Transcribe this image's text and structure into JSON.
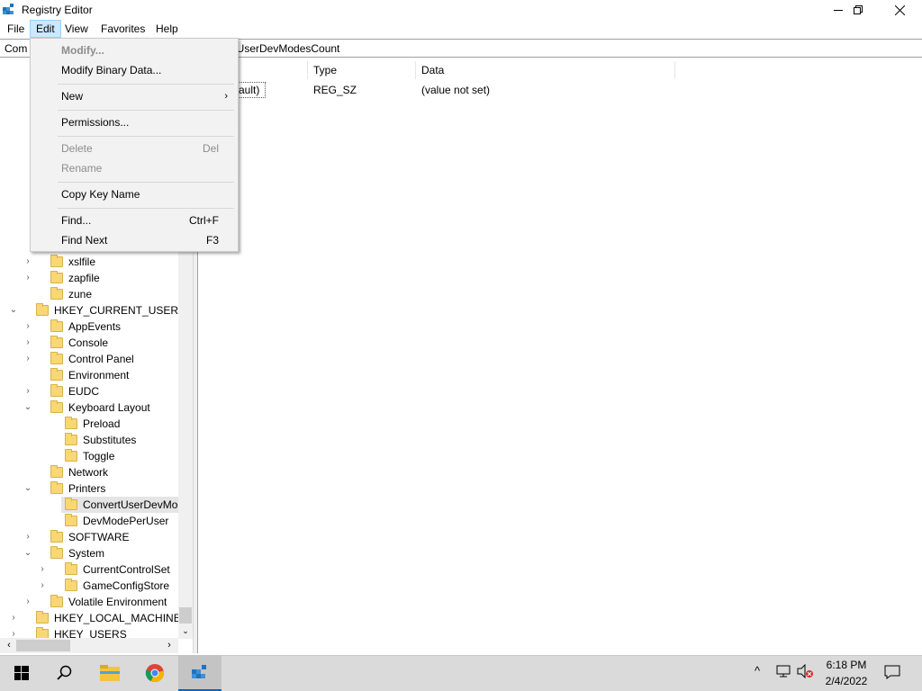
{
  "window": {
    "title": "Registry Editor",
    "controls": {
      "minimize": "—",
      "restore": "❐",
      "close": "✕"
    }
  },
  "menubar": [
    "File",
    "Edit",
    "View",
    "Favorites",
    "Help"
  ],
  "address": {
    "prefix": "Com",
    "visible_tail": "rtUserDevModesCount"
  },
  "edit_menu": {
    "items": [
      {
        "label": "Modify...",
        "shortcut": "",
        "enabled": false,
        "bold": true
      },
      {
        "label": "Modify Binary Data...",
        "shortcut": "",
        "enabled": true
      },
      {
        "label": "New",
        "shortcut": "",
        "enabled": true,
        "submenu": true
      },
      {
        "label": "Permissions...",
        "shortcut": "",
        "enabled": true
      },
      {
        "label": "Delete",
        "shortcut": "Del",
        "enabled": false
      },
      {
        "label": "Rename",
        "shortcut": "",
        "enabled": false
      },
      {
        "label": "Copy Key Name",
        "shortcut": "",
        "enabled": true
      },
      {
        "label": "Find...",
        "shortcut": "Ctrl+F",
        "enabled": true
      },
      {
        "label": "Find Next",
        "shortcut": "F3",
        "enabled": true
      }
    ]
  },
  "tree": [
    {
      "label": "xslfile",
      "level": 1,
      "expander": "›"
    },
    {
      "label": "zapfile",
      "level": 1,
      "expander": "›"
    },
    {
      "label": "zune",
      "level": 1,
      "expander": ""
    },
    {
      "label": "HKEY_CURRENT_USER",
      "level": 0,
      "expander": "⌄"
    },
    {
      "label": "AppEvents",
      "level": 1,
      "expander": "›"
    },
    {
      "label": "Console",
      "level": 1,
      "expander": "›"
    },
    {
      "label": "Control Panel",
      "level": 1,
      "expander": "›"
    },
    {
      "label": "Environment",
      "level": 1,
      "expander": ""
    },
    {
      "label": "EUDC",
      "level": 1,
      "expander": "›"
    },
    {
      "label": "Keyboard Layout",
      "level": 1,
      "expander": "⌄"
    },
    {
      "label": "Preload",
      "level": 2,
      "expander": ""
    },
    {
      "label": "Substitutes",
      "level": 2,
      "expander": ""
    },
    {
      "label": "Toggle",
      "level": 2,
      "expander": ""
    },
    {
      "label": "Network",
      "level": 1,
      "expander": ""
    },
    {
      "label": "Printers",
      "level": 1,
      "expander": "⌄"
    },
    {
      "label": "ConvertUserDevMoc",
      "level": 2,
      "expander": "",
      "selected": true
    },
    {
      "label": "DevModePerUser",
      "level": 2,
      "expander": ""
    },
    {
      "label": "SOFTWARE",
      "level": 1,
      "expander": "›"
    },
    {
      "label": "System",
      "level": 1,
      "expander": "⌄"
    },
    {
      "label": "CurrentControlSet",
      "level": 2,
      "expander": "›"
    },
    {
      "label": "GameConfigStore",
      "level": 2,
      "expander": "›"
    },
    {
      "label": "Volatile Environment",
      "level": 1,
      "expander": "›"
    },
    {
      "label": "HKEY_LOCAL_MACHINE",
      "level": 0,
      "expander": "›"
    },
    {
      "label": "HKEY_USERS",
      "level": 0,
      "expander": "›"
    }
  ],
  "list": {
    "columns": [
      "Type",
      "Data"
    ],
    "rows": [
      {
        "name_fragment": "ault)",
        "type": "REG_SZ",
        "data": "(value not set)"
      }
    ]
  },
  "taskbar": {
    "apps": [
      "start-icon",
      "search-icon",
      "file-explorer-icon",
      "chrome-icon",
      "regedit-icon"
    ],
    "tray_chevron": "^",
    "time": "6:18 PM",
    "date": "2/4/2022"
  },
  "colors": {
    "menu_highlight": "#cce8ff",
    "folder": "#f8d775",
    "taskbar": "#dadada",
    "active_indicator": "#0067c0"
  }
}
